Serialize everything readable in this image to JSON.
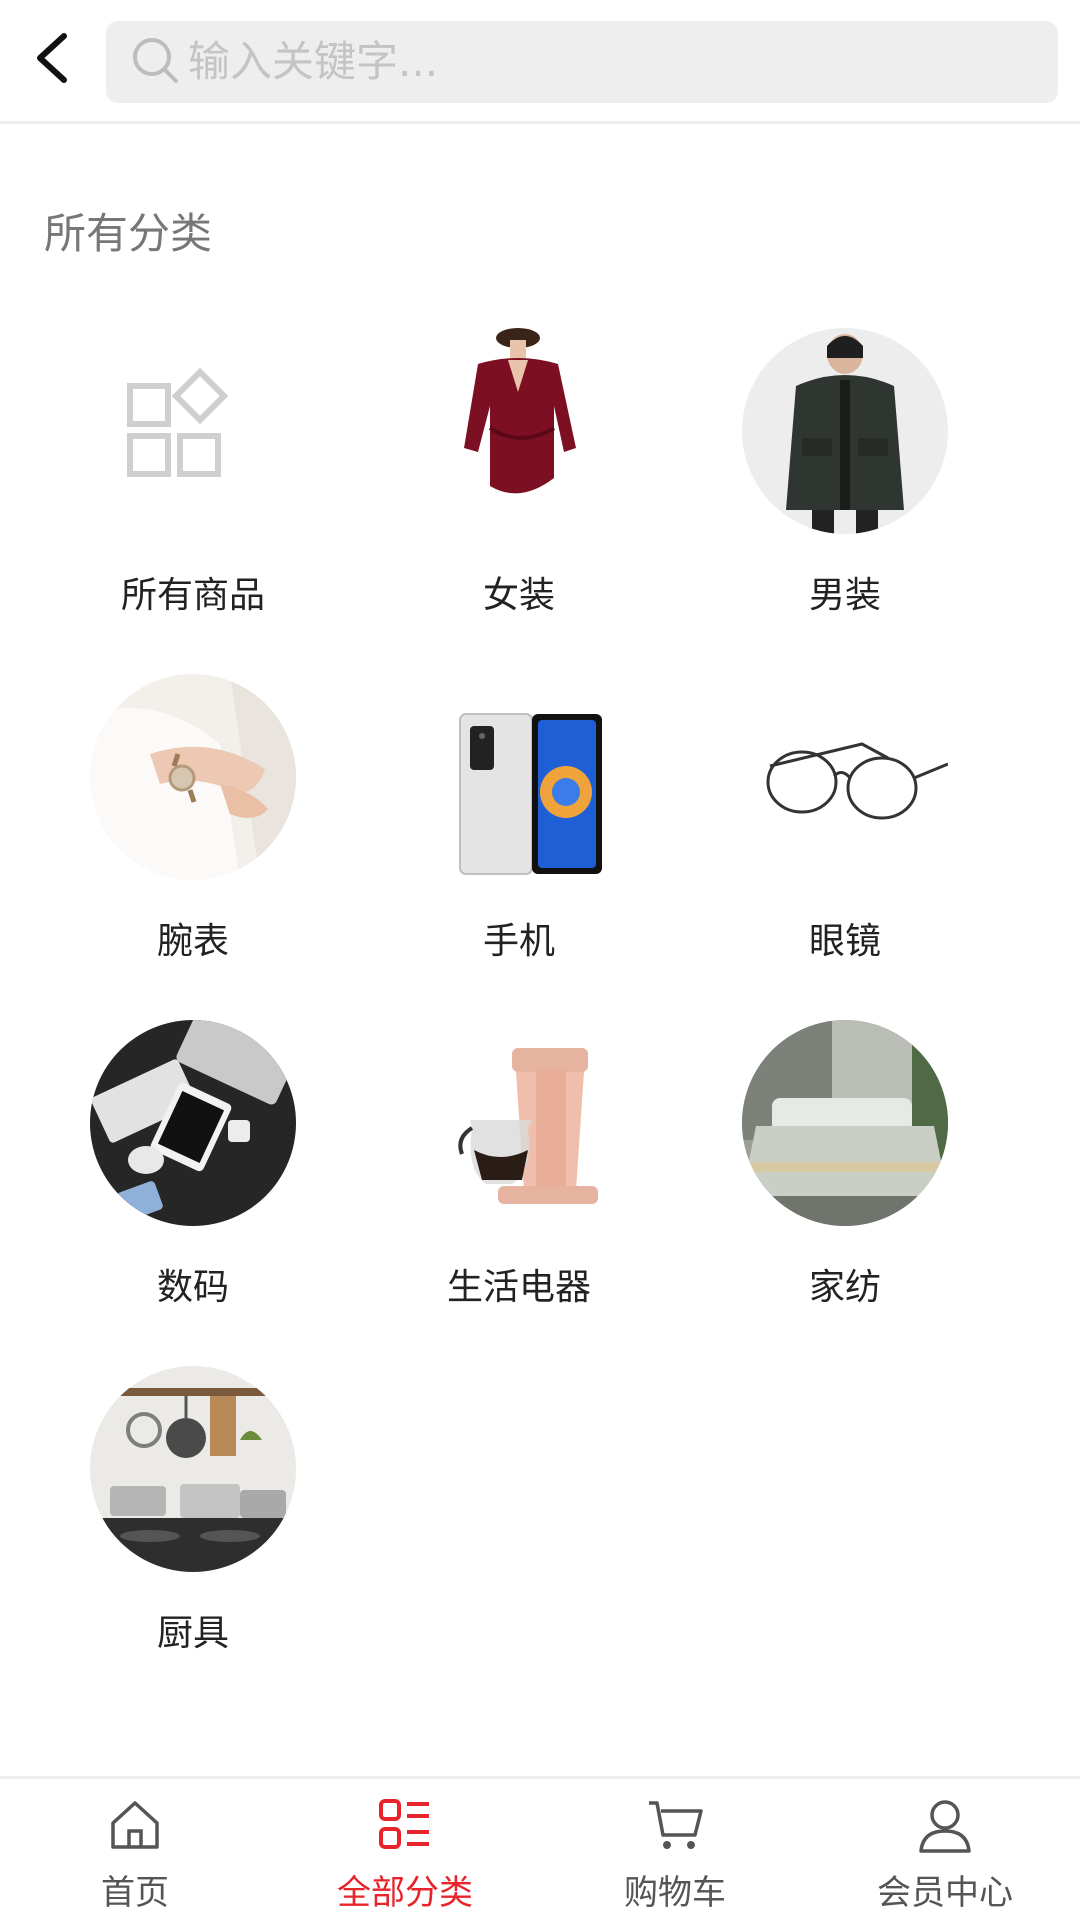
{
  "search": {
    "placeholder": "输入关键字..."
  },
  "section": {
    "title": "所有分类"
  },
  "categories": [
    {
      "label": "所有商品",
      "icon": "grid-apps-icon"
    },
    {
      "label": "女装",
      "icon": "womens-dress-image"
    },
    {
      "label": "男装",
      "icon": "mens-jacket-image"
    },
    {
      "label": "腕表",
      "icon": "wristwatch-image"
    },
    {
      "label": "手机",
      "icon": "foldable-phone-image"
    },
    {
      "label": "眼镜",
      "icon": "eyeglasses-image"
    },
    {
      "label": "数码",
      "icon": "digital-devices-image"
    },
    {
      "label": "生活电器",
      "icon": "coffee-maker-image"
    },
    {
      "label": "家纺",
      "icon": "bedding-image"
    },
    {
      "label": "厨具",
      "icon": "cookware-image"
    }
  ],
  "tabbar": {
    "items": [
      {
        "label": "首页",
        "icon": "home-icon",
        "active": false
      },
      {
        "label": "全部分类",
        "icon": "category-list-icon",
        "active": true
      },
      {
        "label": "购物车",
        "icon": "cart-icon",
        "active": false
      },
      {
        "label": "会员中心",
        "icon": "user-icon",
        "active": false
      }
    ]
  },
  "colors": {
    "accent": "#e8232a",
    "muted_text": "#777777",
    "search_bg": "#eeeeee"
  }
}
